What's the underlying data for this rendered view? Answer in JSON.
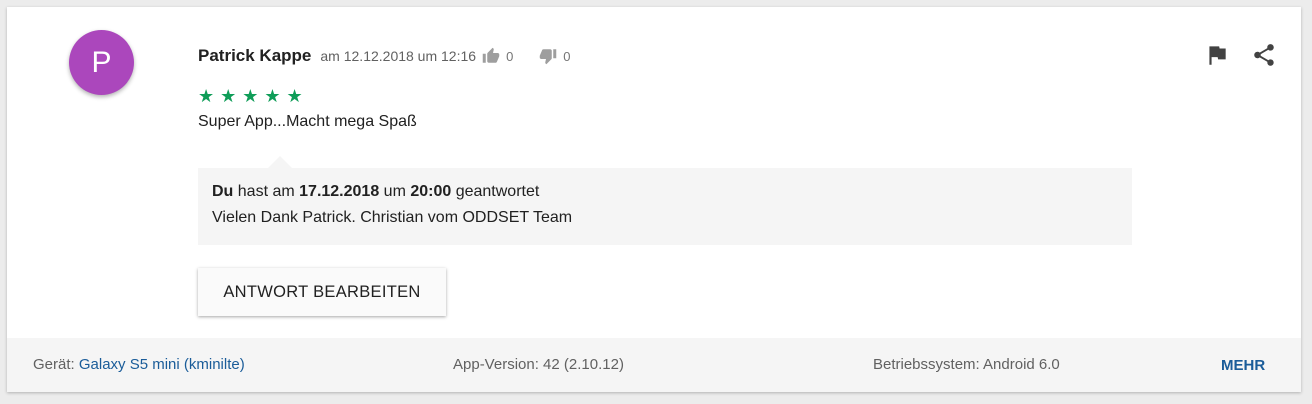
{
  "review": {
    "avatar_letter": "P",
    "avatar_color": "#ab47bc",
    "author": "Patrick Kappe",
    "date": "am 12.12.2018 um 12:16",
    "thumbs_up_count": "0",
    "thumbs_down_count": "0",
    "stars": "★★★★★",
    "rating": 5,
    "text": "Super App...Macht mega Spaß"
  },
  "reply": {
    "who": "Du",
    "t1": " hast am ",
    "date": "17.12.2018",
    "t2": " um ",
    "time": "20:00",
    "t3": " geantwortet",
    "message": "Vielen Dank Patrick. Christian vom ODDSET Team"
  },
  "actions": {
    "edit_label": "ANTWORT BEARBEITEN",
    "flag_icon": "flag-icon",
    "share_icon": "share-icon"
  },
  "footer": {
    "device_label": "Gerät: ",
    "device_value": "Galaxy S5 mini (kminilte)",
    "app_version": "App-Version: 42 (2.10.12)",
    "os": "Betriebssystem: Android 6.0",
    "more_label": "MEHR"
  },
  "colors": {
    "accent_link": "#1a5c99",
    "star_green": "#0f9d58"
  }
}
